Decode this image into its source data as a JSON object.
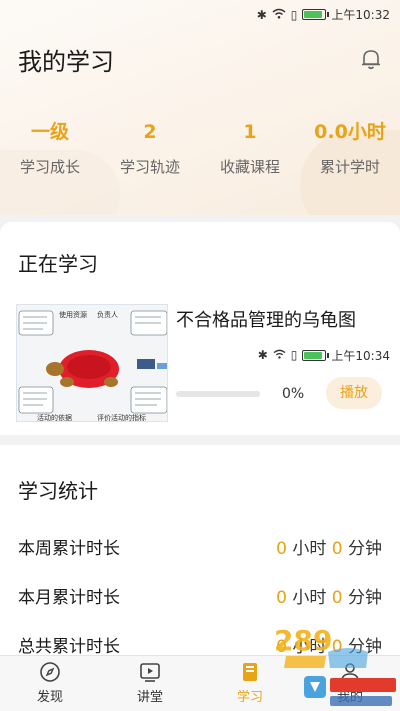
{
  "status_bar": {
    "time": "上午10:32"
  },
  "header": {
    "title": "我的学习",
    "bell_icon": "bell-icon"
  },
  "stats": [
    {
      "value": "一级",
      "label": "学习成长"
    },
    {
      "value": "2",
      "label": "学习轨迹"
    },
    {
      "value": "1",
      "label": "收藏课程"
    },
    {
      "value": "0.0小时",
      "label": "累计学时"
    }
  ],
  "learning": {
    "title": "正在学习",
    "course": {
      "title": "不合格品管理的乌龟图",
      "progress_text": "0%",
      "progress_value": 0,
      "play_label": "播放",
      "thumb_labels": {
        "top": "负责人",
        "left_top": "使用资源",
        "bottom_left": "活动的依据",
        "bottom_right": "评价活动的指标"
      }
    },
    "overlay_status_time": "上午10:34"
  },
  "statistics": {
    "title": "学习统计",
    "rows": [
      {
        "label": "本周累计时长",
        "hours": "0",
        "hours_unit": "小时",
        "minutes": "0",
        "minutes_unit": "分钟"
      },
      {
        "label": "本月累计时长",
        "hours": "0",
        "hours_unit": "小时",
        "minutes": "0",
        "minutes_unit": "分钟"
      },
      {
        "label": "总共累计时长",
        "hours": "0",
        "hours_unit": "小时",
        "minutes": "0",
        "minutes_unit": "分钟"
      }
    ]
  },
  "bottom_nav": [
    {
      "label": "发现",
      "icon": "compass-icon"
    },
    {
      "label": "讲堂",
      "icon": "video-icon"
    },
    {
      "label": "学习",
      "icon": "book-icon"
    },
    {
      "label": "我的",
      "icon": "user-icon"
    }
  ],
  "colors": {
    "accent": "#e8a317",
    "accent_light": "#fbeedd",
    "background": "#f2f2f2"
  }
}
